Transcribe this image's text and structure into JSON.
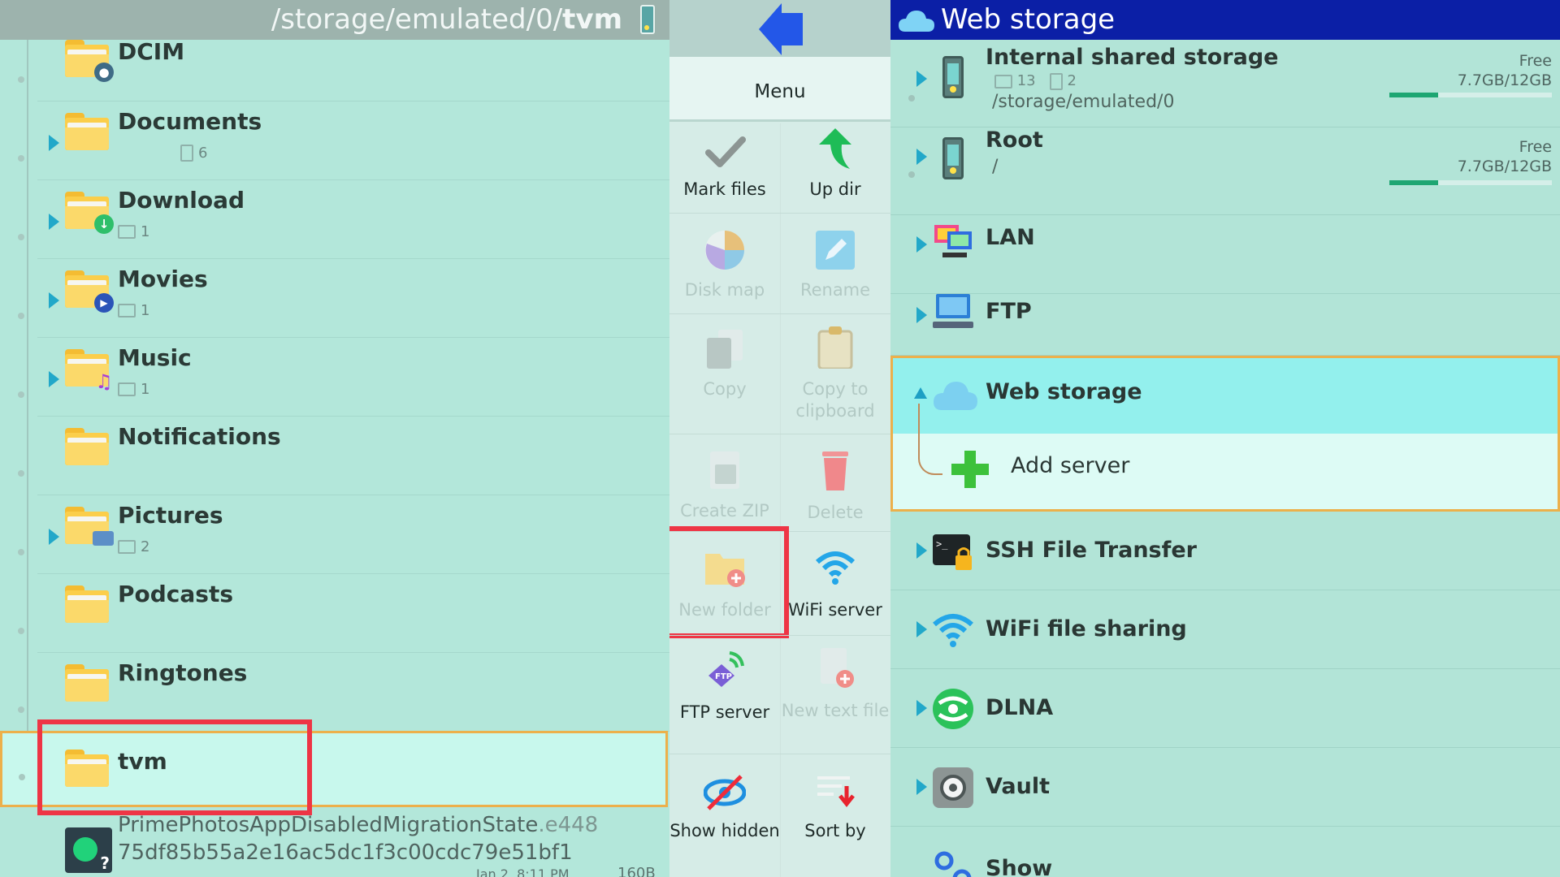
{
  "left_pane": {
    "path_prefix": "/storage/emulated/0/",
    "path_current": "tvm",
    "folders": [
      {
        "name": "DCIM",
        "sub": "",
        "badge": "camera"
      },
      {
        "name": "Documents",
        "sub": "6",
        "sub_type": "file"
      },
      {
        "name": "Download",
        "sub": "1",
        "sub_type": "folder",
        "badge": "download"
      },
      {
        "name": "Movies",
        "sub": "1",
        "sub_type": "folder",
        "badge": "play"
      },
      {
        "name": "Music",
        "sub": "1",
        "sub_type": "folder",
        "badge": "music"
      },
      {
        "name": "Notifications",
        "sub": ""
      },
      {
        "name": "Pictures",
        "sub": "2",
        "sub_type": "folder",
        "badge": "image"
      },
      {
        "name": "Podcasts",
        "sub": ""
      },
      {
        "name": "Ringtones",
        "sub": ""
      },
      {
        "name": "tvm",
        "sub": ""
      }
    ],
    "file": {
      "name_main": "PrimePhotosAppDisabledMigrationState",
      "name_ext": ".e448",
      "name_line2": "75df85b55a2e16ac5dc1f3c00cdc79e51bf1",
      "date": "Jan 2, 8:11 PM",
      "size": "160B"
    }
  },
  "menu": {
    "title": "Menu",
    "items": [
      {
        "label": "Mark files",
        "icon": "check-icon",
        "enabled": true
      },
      {
        "label": "Up dir",
        "icon": "up-arrow-icon",
        "enabled": true
      },
      {
        "label": "Disk map",
        "icon": "pie-chart-icon",
        "enabled": false
      },
      {
        "label": "Rename",
        "icon": "pencil-icon",
        "enabled": false
      },
      {
        "label": "Copy",
        "icon": "copy-icon",
        "enabled": false
      },
      {
        "label": "Copy to clipboard",
        "icon": "clipboard-icon",
        "enabled": false
      },
      {
        "label": "Create ZIP",
        "icon": "zip-icon",
        "enabled": false
      },
      {
        "label": "Delete",
        "icon": "trash-icon",
        "enabled": false
      },
      {
        "label": "New folder",
        "icon": "new-folder-icon",
        "enabled": false
      },
      {
        "label": "WiFi server",
        "icon": "wifi-icon",
        "enabled": true
      },
      {
        "label": "FTP server",
        "icon": "ftp-icon",
        "enabled": true
      },
      {
        "label": "New text file",
        "icon": "new-file-icon",
        "enabled": false
      },
      {
        "label": "Show hidden",
        "icon": "eye-off-icon",
        "enabled": true
      },
      {
        "label": "Sort by",
        "icon": "sort-icon",
        "enabled": true
      }
    ]
  },
  "right_pane": {
    "header": "Web storage",
    "storages": [
      {
        "name": "Internal shared storage",
        "folders": "13",
        "files": "2",
        "path": "/storage/emulated/0",
        "free_label": "Free",
        "free": "7.7GB/12GB",
        "used_fraction": 0.3
      },
      {
        "name": "Root",
        "path": "/",
        "free_label": "Free",
        "free": "7.7GB/12GB",
        "used_fraction": 0.3
      }
    ],
    "items": [
      {
        "name": "LAN",
        "icon": "lan-icon"
      },
      {
        "name": "FTP",
        "icon": "ftp-computer-icon"
      }
    ],
    "selected": {
      "name": "Web storage",
      "child": "Add server"
    },
    "items2": [
      {
        "name": "SSH File Transfer",
        "icon": "terminal-lock-icon"
      },
      {
        "name": "WiFi file sharing",
        "icon": "wifi-icon"
      },
      {
        "name": "DLNA",
        "icon": "dlna-icon"
      },
      {
        "name": "Vault",
        "icon": "vault-icon"
      },
      {
        "name": "Show",
        "icon": "show-icon"
      }
    ]
  },
  "colors": {
    "accent_blue": "#0b1fa6",
    "selection_border": "#ecb04b",
    "highlight_red": "#ee3545",
    "expand_arrow": "#22a8c9"
  }
}
